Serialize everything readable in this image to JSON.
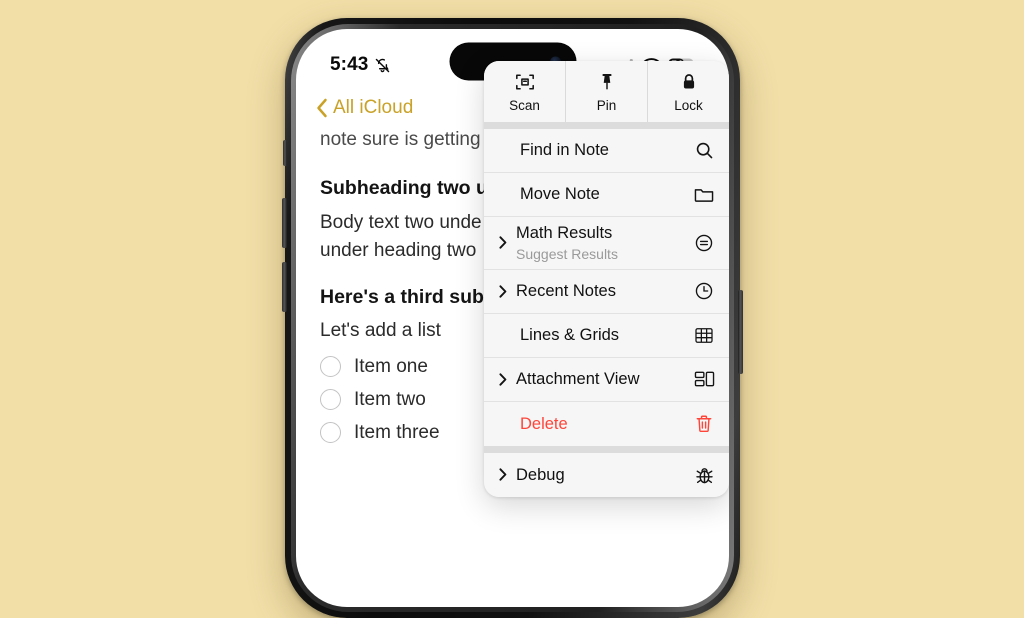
{
  "theme": {
    "page_background": "#f2dfa8",
    "accent_gold": "#c9a227",
    "destructive_red": "#ff453a",
    "menu_background": "#f6f6f6",
    "subtitle_gray": "#9a9a9a"
  },
  "status_bar": {
    "time": "5:43",
    "mute_icon": "bell-slash-icon",
    "cellular_icon": "cellular-bars-icon",
    "wifi_icon": "wifi-icon",
    "battery_level": "51"
  },
  "nav_bar": {
    "back_label": "All iCloud",
    "back_icon": "chevron-left-icon",
    "share_icon": "share-icon",
    "more_icon": "ellipsis-circle-icon"
  },
  "note": {
    "clipped_line": "note sure is getting",
    "blocks": [
      {
        "type": "heading",
        "text": "Subheading two u"
      },
      {
        "type": "body",
        "text": "Body text two unde"
      },
      {
        "type": "body",
        "text": "under heading two"
      },
      {
        "type": "heading",
        "text": "Here's a third sub"
      },
      {
        "type": "body",
        "text": "Let's add a list"
      }
    ],
    "checklist": [
      {
        "label": "Item one",
        "checked": false
      },
      {
        "label": "Item two",
        "checked": false
      },
      {
        "label": "Item three",
        "checked": false
      }
    ]
  },
  "context_menu": {
    "quick_actions": [
      {
        "label": "Scan",
        "icon": "document-scan-icon"
      },
      {
        "label": "Pin",
        "icon": "pin-icon"
      },
      {
        "label": "Lock",
        "icon": "lock-icon"
      }
    ],
    "groups": [
      {
        "items": [
          {
            "title": "Find in Note",
            "subtitle": "",
            "icon": "magnifier-icon",
            "submenu": false,
            "destructive": false
          },
          {
            "title": "Move Note",
            "subtitle": "",
            "icon": "folder-icon",
            "submenu": false,
            "destructive": false
          },
          {
            "title": "Math Results",
            "subtitle": "Suggest Results",
            "icon": "equals-circle-icon",
            "submenu": true,
            "destructive": false
          },
          {
            "title": "Recent Notes",
            "subtitle": "",
            "icon": "clock-icon",
            "submenu": true,
            "destructive": false
          },
          {
            "title": "Lines & Grids",
            "subtitle": "",
            "icon": "grid-table-icon",
            "submenu": false,
            "destructive": false
          },
          {
            "title": "Attachment View",
            "subtitle": "",
            "icon": "attachment-layout-icon",
            "submenu": true,
            "destructive": false
          },
          {
            "title": "Delete",
            "subtitle": "",
            "icon": "trash-icon",
            "submenu": false,
            "destructive": true
          }
        ]
      },
      {
        "items": [
          {
            "title": "Debug",
            "subtitle": "",
            "icon": "bug-icon",
            "submenu": true,
            "destructive": false
          }
        ]
      }
    ]
  }
}
